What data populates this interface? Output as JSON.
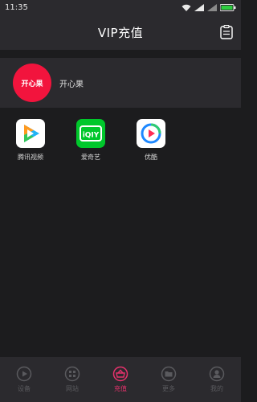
{
  "status_bar": {
    "time": "11:35",
    "battery_color": "#2ecc40"
  },
  "header": {
    "title": "VIP充值",
    "right_icon": "clipboard-icon"
  },
  "provider": {
    "logo_text": "开心果",
    "name": "开心果",
    "logo_color": "#f2143d"
  },
  "apps": [
    {
      "label": "腾讯视频",
      "icon": "tencent-video-icon"
    },
    {
      "label": "爱奇艺",
      "icon": "iqiyi-icon"
    },
    {
      "label": "优酷",
      "icon": "youku-icon"
    }
  ],
  "tabs": [
    {
      "label": "设备",
      "icon": "play-circle-icon",
      "active": false
    },
    {
      "label": "网站",
      "icon": "grid-icon",
      "active": false
    },
    {
      "label": "充值",
      "icon": "recharge-icon",
      "active": true
    },
    {
      "label": "更多",
      "icon": "folder-icon",
      "active": false
    },
    {
      "label": "我的",
      "icon": "user-icon",
      "active": false
    }
  ],
  "colors": {
    "background": "#1c1c1e",
    "bar": "#2b2a2e",
    "accent": "#e6326c",
    "tab_inactive": "#5a5a5e"
  }
}
